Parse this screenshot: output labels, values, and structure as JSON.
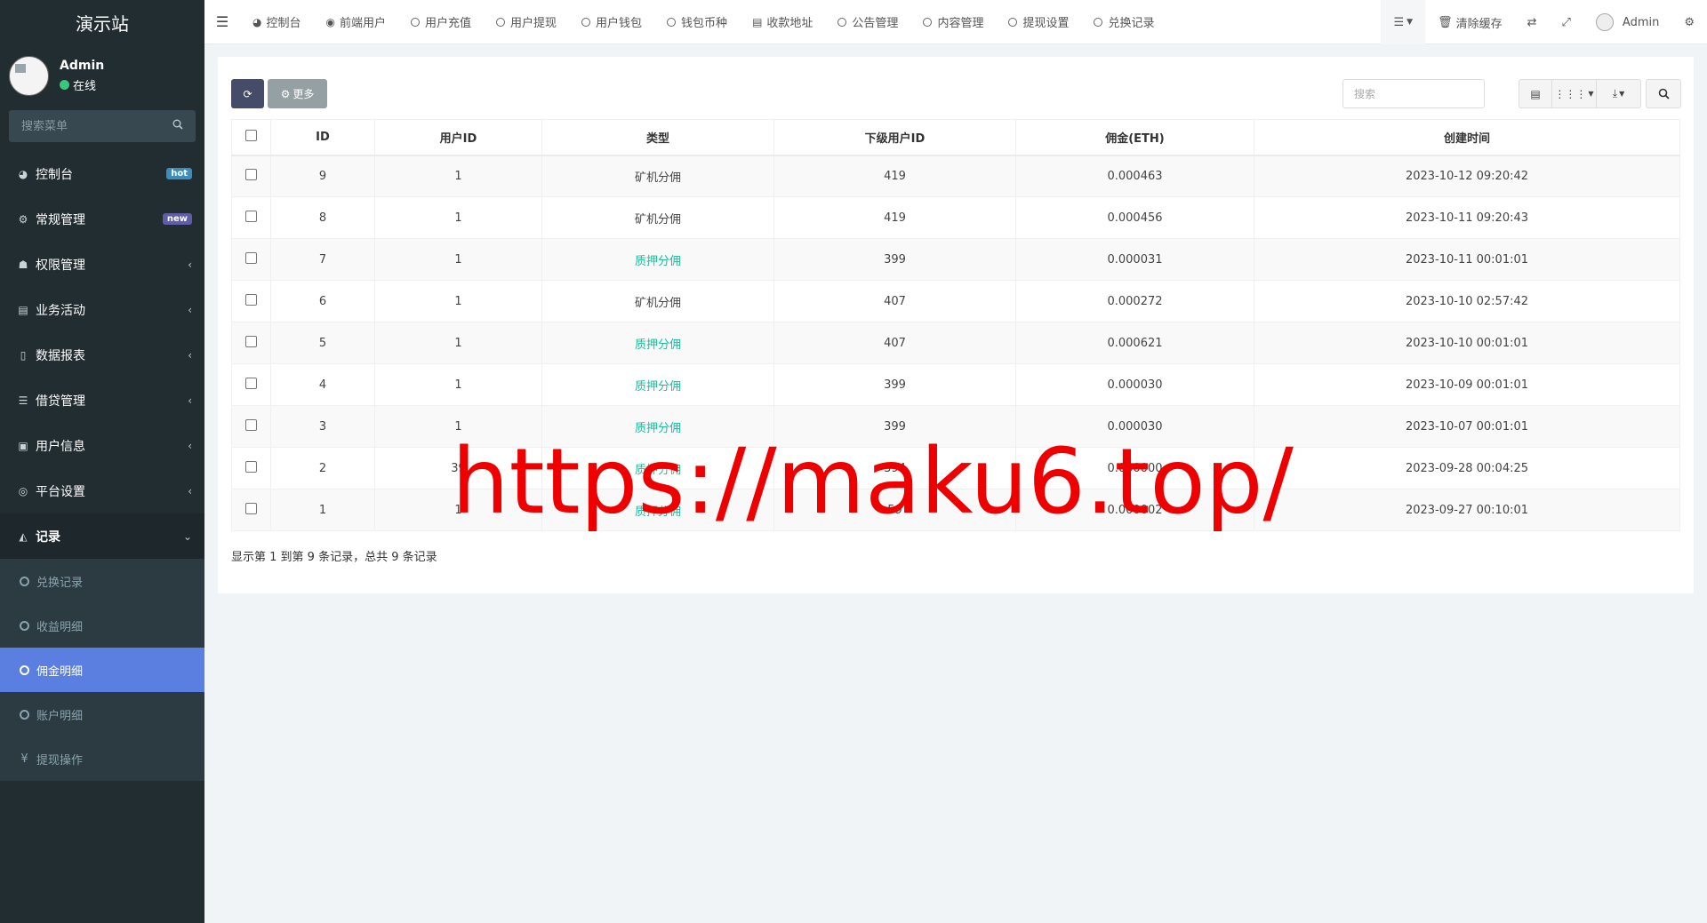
{
  "sidebar": {
    "brand": "演示站",
    "user": {
      "name": "Admin",
      "status": "在线"
    },
    "search_placeholder": "搜索菜单",
    "menu": [
      {
        "label": "控制台",
        "icon": "dashboard-icon",
        "badge": "hot"
      },
      {
        "label": "常规管理",
        "icon": "cogs-icon",
        "badge": "new"
      },
      {
        "label": "权限管理",
        "icon": "group-icon"
      },
      {
        "label": "业务活动",
        "icon": "newspaper-icon"
      },
      {
        "label": "数据报表",
        "icon": "file-icon"
      },
      {
        "label": "借贷管理",
        "icon": "list-icon"
      },
      {
        "label": "用户信息",
        "icon": "contact-book-icon"
      },
      {
        "label": "平台设置",
        "icon": "circle-gear-icon"
      },
      {
        "label": "记录",
        "icon": "area-chart-icon"
      }
    ],
    "submenu": [
      {
        "label": "兑换记录"
      },
      {
        "label": "收益明细"
      },
      {
        "label": "佣金明细",
        "active": true
      },
      {
        "label": "账户明细"
      },
      {
        "label": "提现操作",
        "icon": "yen-icon"
      }
    ]
  },
  "topnav": {
    "tabs": [
      "控制台",
      "前端用户",
      "用户充值",
      "用户提现",
      "用户钱包",
      "钱包币种",
      "收款地址",
      "公告管理",
      "内容管理",
      "提现设置",
      "兑换记录"
    ],
    "clear_cache": "清除缓存",
    "admin": "Admin"
  },
  "toolbar": {
    "more_label": "更多",
    "search_placeholder": "搜索"
  },
  "table": {
    "headers": [
      "ID",
      "用户ID",
      "类型",
      "下级用户ID",
      "佣金(ETH)",
      "创建时间"
    ],
    "rows": [
      [
        "9",
        "1",
        "矿机分佣",
        "419",
        "0.000463",
        "2023-10-12 09:20:42"
      ],
      [
        "8",
        "1",
        "矿机分佣",
        "419",
        "0.000456",
        "2023-10-11 09:20:43"
      ],
      [
        "7",
        "1",
        "质押分佣",
        "399",
        "0.000031",
        "2023-10-11 00:01:01"
      ],
      [
        "6",
        "1",
        "矿机分佣",
        "407",
        "0.000272",
        "2023-10-10 02:57:42"
      ],
      [
        "5",
        "1",
        "质押分佣",
        "407",
        "0.000621",
        "2023-10-10 00:01:01"
      ],
      [
        "4",
        "1",
        "质押分佣",
        "399",
        "0.000030",
        "2023-10-09 00:01:01"
      ],
      [
        "3",
        "1",
        "质押分佣",
        "399",
        "0.000030",
        "2023-10-07 00:01:01"
      ],
      [
        "2",
        "39",
        "质押分佣",
        "394",
        "0.000000",
        "2023-09-28 00:04:25"
      ],
      [
        "1",
        "1",
        "质押分佣",
        "59",
        "0.000002",
        "2023-09-27 00:10:01"
      ]
    ]
  },
  "summary": "显示第 1 到第 9 条记录，总共 9 条记录",
  "watermark": "https://maku6.top/",
  "colors": {
    "sidebar_bg": "#222d32",
    "active_item": "#5b7fe0",
    "pledge_text": "#18bc9c",
    "watermark": "#ee0000"
  }
}
